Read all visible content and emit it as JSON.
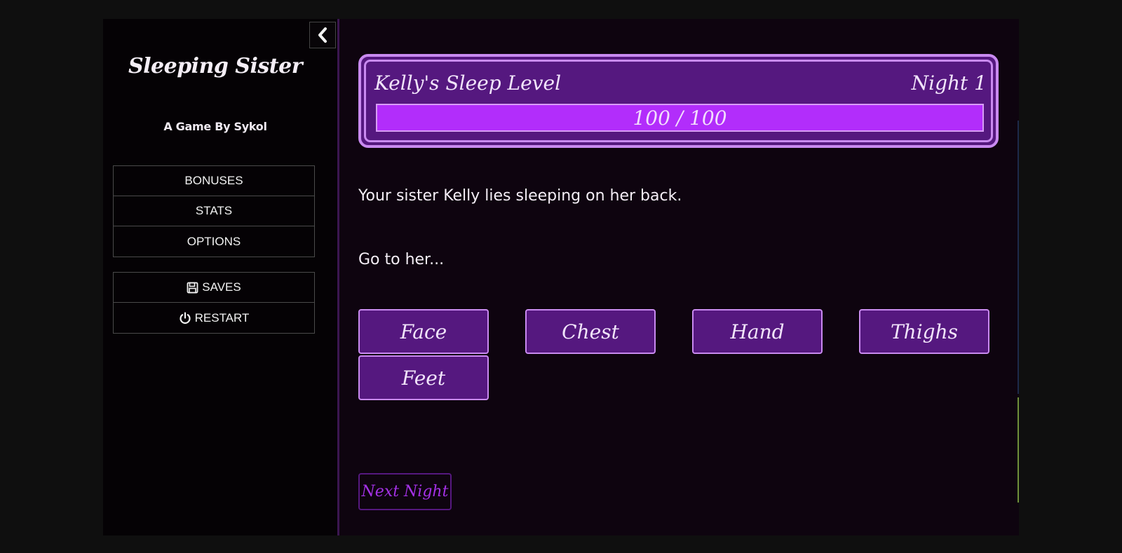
{
  "sidebar": {
    "title": "Sleeping Sister",
    "author": "A Game By Sykol",
    "menu_top": [
      {
        "label": "BONUSES"
      },
      {
        "label": "STATS"
      },
      {
        "label": "OPTIONS"
      }
    ],
    "menu_bottom": [
      {
        "label": "SAVES",
        "icon": "floppy-disk-icon"
      },
      {
        "label": "RESTART",
        "icon": "power-icon"
      }
    ],
    "collapse_icon": "chevron-left-icon"
  },
  "sleep_panel": {
    "label": "Kelly's Sleep Level",
    "night": "Night 1",
    "value_text": "100 / 100",
    "level_fraction": 1.0
  },
  "passage": {
    "line1": "Your sister Kelly lies sleeping on her back.",
    "line2": "Go to her..."
  },
  "choices": [
    {
      "label": "Face"
    },
    {
      "label": "Chest"
    },
    {
      "label": "Hand"
    },
    {
      "label": "Thighs"
    },
    {
      "label": "Feet"
    }
  ],
  "next_night": "Next Night",
  "colors": {
    "accent": "#b22dfb",
    "panel": "#55187f",
    "border": "#c98af0",
    "background": "#0e040f"
  }
}
